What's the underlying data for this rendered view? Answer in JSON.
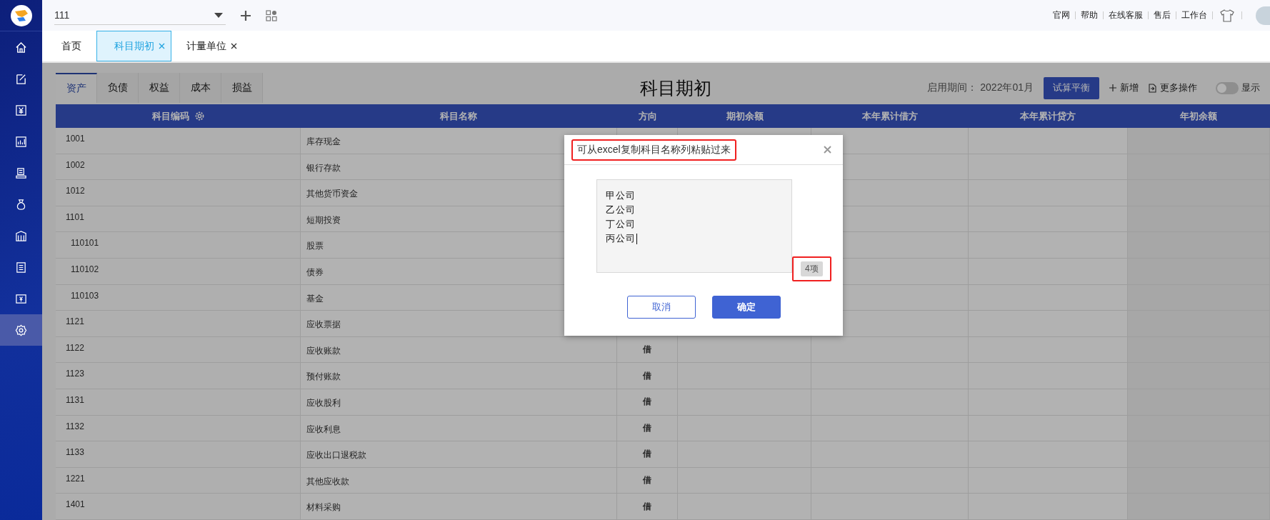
{
  "topbar": {
    "company": "111",
    "links": [
      "官网",
      "帮助",
      "在线客服",
      "售后",
      "工作台"
    ]
  },
  "sidebar": {
    "items": [
      {
        "kind": "home",
        "selected": false
      },
      {
        "kind": "edit",
        "selected": false
      },
      {
        "kind": "yen",
        "selected": false
      },
      {
        "kind": "chart",
        "selected": false
      },
      {
        "kind": "book",
        "selected": false
      },
      {
        "kind": "bag",
        "selected": false
      },
      {
        "kind": "building",
        "selected": false
      },
      {
        "kind": "doc",
        "selected": false
      },
      {
        "kind": "exchange",
        "selected": false
      },
      {
        "kind": "settings",
        "selected": true
      }
    ]
  },
  "tabs": [
    {
      "label": "首页",
      "selected": false,
      "closable": false
    },
    {
      "label": "科目期初",
      "selected": true,
      "closable": true
    },
    {
      "label": "计量单位",
      "selected": false,
      "closable": true
    }
  ],
  "subtabs": [
    {
      "label": "资产",
      "selected": true
    },
    {
      "label": "负债",
      "selected": false
    },
    {
      "label": "权益",
      "selected": false
    },
    {
      "label": "成本",
      "selected": false
    },
    {
      "label": "损益",
      "selected": false
    }
  ],
  "page_title": "科目期初",
  "period_label": "启用期间：",
  "period_value": "2022年01月",
  "actions": {
    "trial_balance": "试算平衡",
    "add": "新增",
    "more": "更多操作",
    "toggle_label": "显示",
    "toggle_on": false
  },
  "table": {
    "columns": [
      "科目编码",
      "科目名称",
      "方向",
      "期初余额",
      "本年累计借方",
      "本年累计贷方",
      "年初余额"
    ],
    "rows": [
      {
        "code": "1001",
        "name": "库存现金"
      },
      {
        "code": "1002",
        "name": "银行存款"
      },
      {
        "code": "1012",
        "name": "其他货币资金"
      },
      {
        "code": "1101",
        "name": "短期投资",
        "children": [
          {
            "code": "110101",
            "name": "股票"
          },
          {
            "code": "110102",
            "name": "债券"
          },
          {
            "code": "110103",
            "name": "基金"
          }
        ]
      },
      {
        "code": "1121",
        "name": "应收票据"
      },
      {
        "code": "1122",
        "name": "应收账款",
        "direction": "借"
      },
      {
        "code": "1123",
        "name": "预付账款",
        "direction": "借"
      },
      {
        "code": "1131",
        "name": "应收股利",
        "direction": "借"
      },
      {
        "code": "1132",
        "name": "应收利息",
        "direction": "借"
      },
      {
        "code": "1133",
        "name": "应收出口退税款",
        "direction": "借"
      },
      {
        "code": "1221",
        "name": "其他应收款",
        "direction": "借"
      },
      {
        "code": "1401",
        "name": "材料采购",
        "direction": "借"
      }
    ]
  },
  "dialog": {
    "title": "可从excel复制科目名称列粘贴过来",
    "title_highlighted": true,
    "lines": [
      "甲公司",
      "乙公司",
      "丁公司",
      "丙公司"
    ],
    "count": "4项",
    "count_highlighted": true,
    "buttons": [
      {
        "label": "取消",
        "kind": "secondary"
      },
      {
        "label": "确定",
        "kind": "primary"
      }
    ]
  }
}
